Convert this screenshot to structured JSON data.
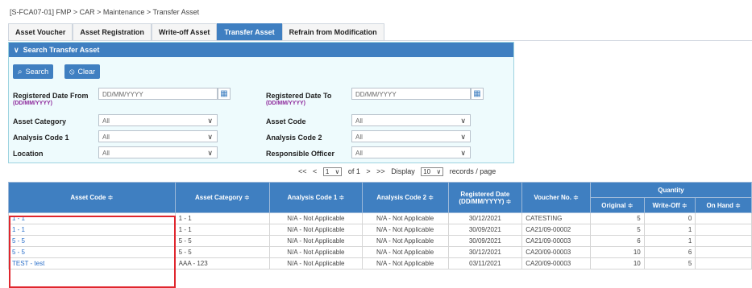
{
  "breadcrumb": "[S-FCA07-01] FMP  >  CAR  >  Maintenance  >  Transfer Asset",
  "tabs": [
    "Asset Voucher",
    "Asset Registration",
    "Write-off Asset",
    "Transfer Asset",
    "Refrain from Modification"
  ],
  "active_tab": "Transfer Asset",
  "panel": {
    "title": "Search Transfer Asset",
    "search_label": "Search",
    "clear_label": "Clear"
  },
  "form": {
    "reg_date_from_label": "Registered Date From",
    "reg_date_to_label": "Registered Date To",
    "date_format": "(DD/MM/YYYY)",
    "date_placeholder": "DD/MM/YYYY",
    "asset_category_label": "Asset Category",
    "asset_code_label": "Asset Code",
    "analysis_code1_label": "Analysis Code 1",
    "analysis_code2_label": "Analysis Code 2",
    "location_label": "Location",
    "responsible_officer_label": "Responsible Officer",
    "all": "All"
  },
  "pager": {
    "first": "<<",
    "prev": "<",
    "page": "1",
    "of": "of 1",
    "next": ">",
    "last": ">>",
    "display": "Display",
    "per_page": "10",
    "suffix": "records / page"
  },
  "table": {
    "headers": {
      "asset_code": "Asset Code ≑",
      "asset_category": "Asset Category ≑",
      "analysis_code1": "Analysis Code 1 ≑",
      "analysis_code2": "Analysis Code 2 ≑",
      "registered_date": "Registered Date",
      "registered_date_fmt": "(DD/MM/YYYY) ≑",
      "voucher_no": "Voucher No. ≑",
      "quantity": "Quantity",
      "original": "Original ≑",
      "write_off": "Write-Off ≑",
      "on_hand": "On Hand ≑"
    },
    "rows": [
      {
        "code": "1 - 1",
        "category": "1 - 1",
        "a1": "N/A - Not Applicable",
        "a2": "N/A - Not Applicable",
        "date": "30/12/2021",
        "voucher": "CATESTING",
        "original": "5",
        "writeoff": "0",
        "onhand": ""
      },
      {
        "code": "1 - 1",
        "category": "1 - 1",
        "a1": "N/A - Not Applicable",
        "a2": "N/A - Not Applicable",
        "date": "30/09/2021",
        "voucher": "CA21/09-00002",
        "original": "5",
        "writeoff": "1",
        "onhand": ""
      },
      {
        "code": "5 - 5",
        "category": "5 - 5",
        "a1": "N/A - Not Applicable",
        "a2": "N/A - Not Applicable",
        "date": "30/09/2021",
        "voucher": "CA21/09-00003",
        "original": "6",
        "writeoff": "1",
        "onhand": ""
      },
      {
        "code": "5 - 5",
        "category": "5 - 5",
        "a1": "N/A - Not Applicable",
        "a2": "N/A - Not Applicable",
        "date": "30/12/2021",
        "voucher": "CA20/09-00003",
        "original": "10",
        "writeoff": "6",
        "onhand": ""
      },
      {
        "code": "TEST - test",
        "category": "AAA - 123",
        "a1": "N/A - Not Applicable",
        "a2": "N/A - Not Applicable",
        "date": "03/11/2021",
        "voucher": "CA20/09-00003",
        "original": "10",
        "writeoff": "5",
        "onhand": ""
      }
    ]
  }
}
